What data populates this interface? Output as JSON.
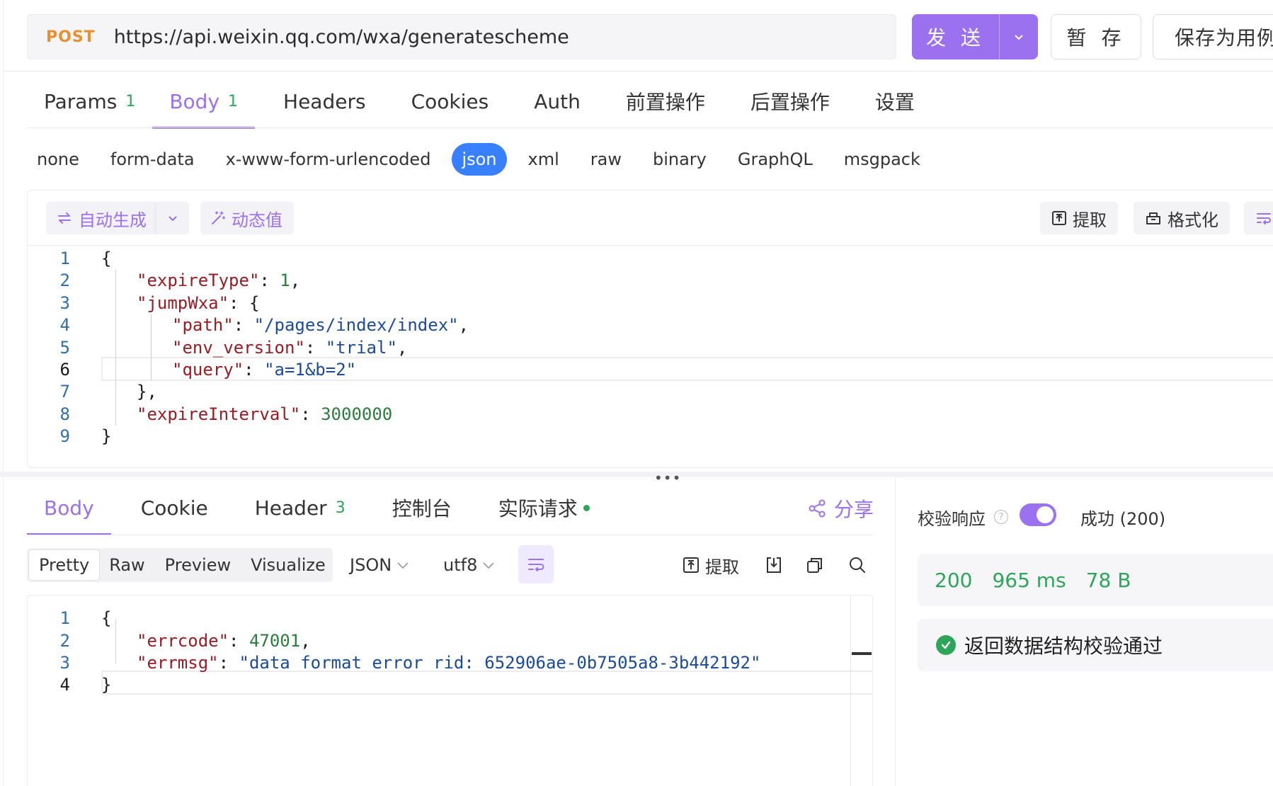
{
  "request": {
    "method": "POST",
    "url": "https://api.weixin.qq.com/wxa/generatescheme",
    "send_label": "发 送",
    "save_label": "暂 存",
    "save_as_label": "保存为用例"
  },
  "req_tabs": [
    {
      "label": "Params",
      "count": "1"
    },
    {
      "label": "Body",
      "count": "1",
      "active": true
    },
    {
      "label": "Headers",
      "count": ""
    },
    {
      "label": "Cookies",
      "count": ""
    },
    {
      "label": "Auth",
      "count": ""
    },
    {
      "label": "前置操作",
      "count": ""
    },
    {
      "label": "后置操作",
      "count": ""
    },
    {
      "label": "设置",
      "count": ""
    }
  ],
  "body_types": [
    "none",
    "form-data",
    "x-www-form-urlencoded",
    "json",
    "xml",
    "raw",
    "binary",
    "GraphQL",
    "msgpack"
  ],
  "body_type_selected": "json",
  "editor_toolbar": {
    "auto_generate": "自动生成",
    "dynamic_value": "动态值",
    "extract": "提取",
    "format": "格式化"
  },
  "request_body_lines": [
    "{",
    "\"expireType\": 1,",
    "\"jumpWxa\": {",
    "\"path\": \"/pages/index/index\",",
    "\"env_version\": \"trial\",",
    "\"query\": \"a=1&b=2\"",
    "},",
    "\"expireInterval\": 3000000",
    "}"
  ],
  "response_tabs": [
    {
      "label": "Body",
      "count": "",
      "active": true
    },
    {
      "label": "Cookie",
      "count": ""
    },
    {
      "label": "Header",
      "count": "3"
    },
    {
      "label": "控制台",
      "count": ""
    },
    {
      "label": "实际请求",
      "count": "",
      "dot": true
    }
  ],
  "share_label": "分享",
  "view_modes": [
    "Pretty",
    "Raw",
    "Preview",
    "Visualize"
  ],
  "view_mode_selected": "Pretty",
  "format_select": "JSON",
  "encoding_select": "utf8",
  "response_extract_label": "提取",
  "response_body_lines": [
    "{",
    "\"errcode\": 47001,",
    "\"errmsg\": \"data format error rid: 652906ae-0b7505a8-3b442192\"",
    "}"
  ],
  "validation": {
    "label": "校验响应",
    "help_icon": "question-icon",
    "enabled": true,
    "status": "成功 (200)",
    "status_code": "200",
    "time": "965 ms",
    "size": "78 B",
    "result": "返回数据结构校验通过"
  },
  "colors": {
    "accent": "#9b71f0",
    "method": "#e8902c",
    "success": "#2fa55a",
    "json_active": "#3880ff",
    "json_key": "#9a1c22",
    "json_string": "#1b4b9a",
    "json_number": "#2a7d3c"
  }
}
